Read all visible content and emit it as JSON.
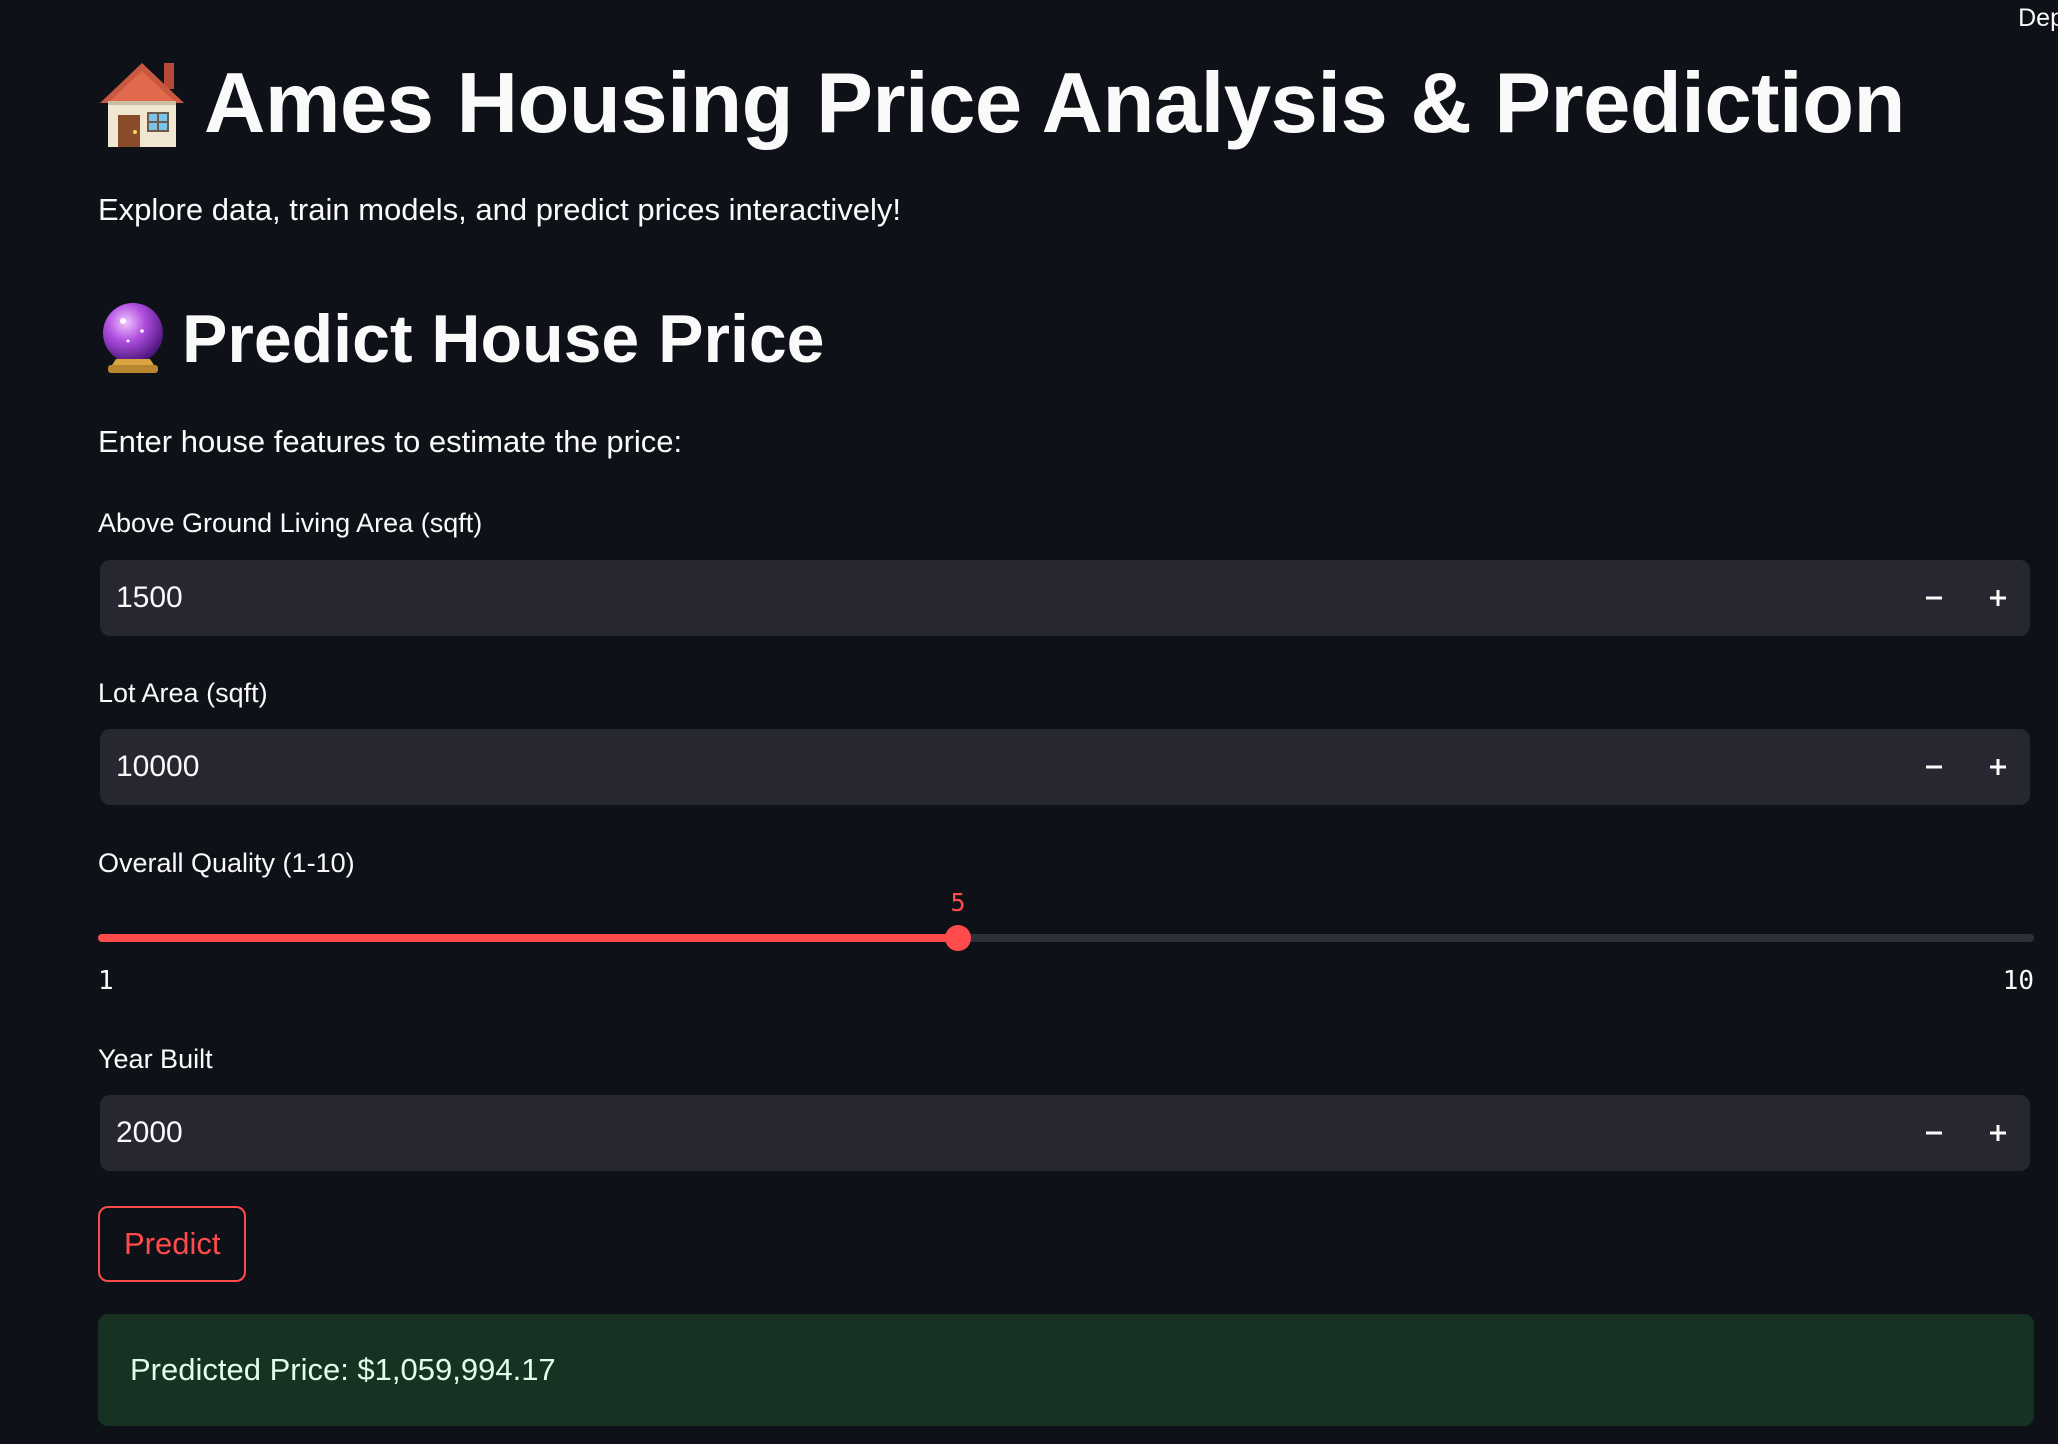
{
  "header": {
    "deploy_label": "Dep"
  },
  "app": {
    "title": "Ames Housing Price Analysis & Prediction",
    "title_icon": "house-emoji",
    "subtitle": "Explore data, train models, and predict prices interactively!"
  },
  "predict": {
    "heading": "Predict House Price",
    "heading_icon": "crystal-ball-emoji",
    "intro": "Enter house features to estimate the price:",
    "living_area": {
      "label": "Above Ground Living Area (sqft)",
      "value": "1500"
    },
    "lot_area": {
      "label": "Lot Area (sqft)",
      "value": "10000"
    },
    "quality": {
      "label": "Overall Quality (1-10)",
      "value": "5",
      "min": "1",
      "max": "10",
      "fraction": 0.4444
    },
    "year_built": {
      "label": "Year Built",
      "value": "2000"
    },
    "button_label": "Predict",
    "result_text": "Predicted Price: $1,059,994.17"
  },
  "colors": {
    "background": "#0e1117",
    "accent": "#ff4b4b",
    "input_bg": "#262730",
    "success_bg": "#173223",
    "success_text": "#dffde9"
  }
}
